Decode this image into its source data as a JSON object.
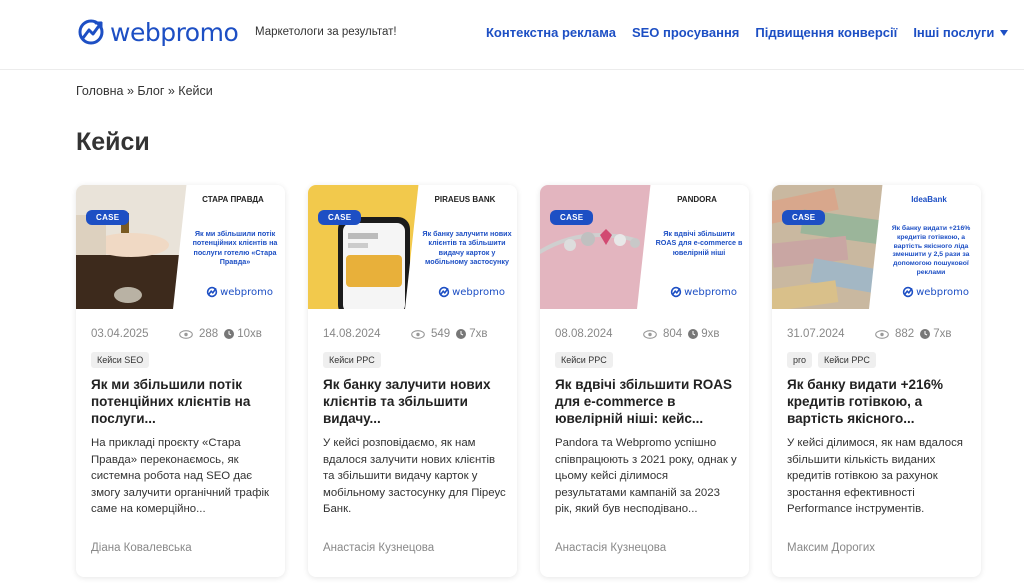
{
  "header": {
    "logo_text": "webpromo",
    "tagline": "Маркетологи за результат!",
    "nav": [
      "Контекстна реклама",
      "SEO просування",
      "Підвищення конверсії",
      "Інші послуги"
    ]
  },
  "breadcrumb": "Головна » Блог » Кейси",
  "page_title": "Кейси",
  "colors": {
    "brand": "#1d4fc4"
  },
  "cards": [
    {
      "badge": "CASE",
      "brand": "СТАРА ПРАВДА",
      "caption": "Як ми збільшили потік потенційних клієнтів на послуги готелю «Стара Правда»",
      "logo": "webpromo",
      "date": "03.04.2025",
      "views": "288",
      "read_time": "10хв",
      "tags": [
        "Кейси SEO"
      ],
      "title": "Як ми збільшили потік потенційних клієнтів на послуги...",
      "excerpt": "На прикладі проєкту «Стара Правда» переконаємось, як системна робота над SEO дає змогу залучити органічний трафік саме на комерційно...",
      "author": "Діана Ковалевська"
    },
    {
      "badge": "CASE",
      "brand": "PIRAEUS BANK",
      "caption": "Як банку залучити нових клієнтів та збільшити видачу карток у мобільному застосунку",
      "logo": "webpromo",
      "date": "14.08.2024",
      "views": "549",
      "read_time": "7хв",
      "tags": [
        "Кейси PPC"
      ],
      "title": "Як банку залучити нових клієнтів та збільшити видачу...",
      "excerpt": "У кейсі розповідаємо, як нам вдалося залучити нових клієнтів та збільшити видачу карток у мобільному застосунку для Піреус Банк.",
      "author": "Анастасія Кузнецова"
    },
    {
      "badge": "CASE",
      "brand": "PANDORA",
      "caption": "Як вдвічі збільшити ROAS для e-commerce в ювелірній ніші",
      "logo": "webpromo",
      "date": "08.08.2024",
      "views": "804",
      "read_time": "9хв",
      "tags": [
        "Кейси PPC"
      ],
      "title": "Як вдвічі збільшити ROAS для e-commerce в ювелірній ніші: кейс...",
      "excerpt": "Pandora та Webpromo успішно співпрацюють з 2021 року, однак у цьому кейсі ділимося результатами кампаній за 2023 рік, який був несподівано...",
      "author": "Анастасія Кузнецова"
    },
    {
      "badge": "CASE",
      "brand": "IdeaBank",
      "caption": "Як банку видати +216% кредитів готівкою, а вартість якісного ліда зменшити у 2,5 рази за допомогою пошукової реклами",
      "logo": "webpromo",
      "date": "31.07.2024",
      "views": "882",
      "read_time": "7хв",
      "tags": [
        "pro",
        "Кейси PPC"
      ],
      "title": "Як банку видати +216% кредитів готівкою, а вартість якісного...",
      "excerpt": "У кейсі ділимося, як нам вдалося збільшити кількість виданих кредитів готівкою за рахунок зростання ефективності Performance інструментів.",
      "author": "Максим Дорогих"
    }
  ]
}
